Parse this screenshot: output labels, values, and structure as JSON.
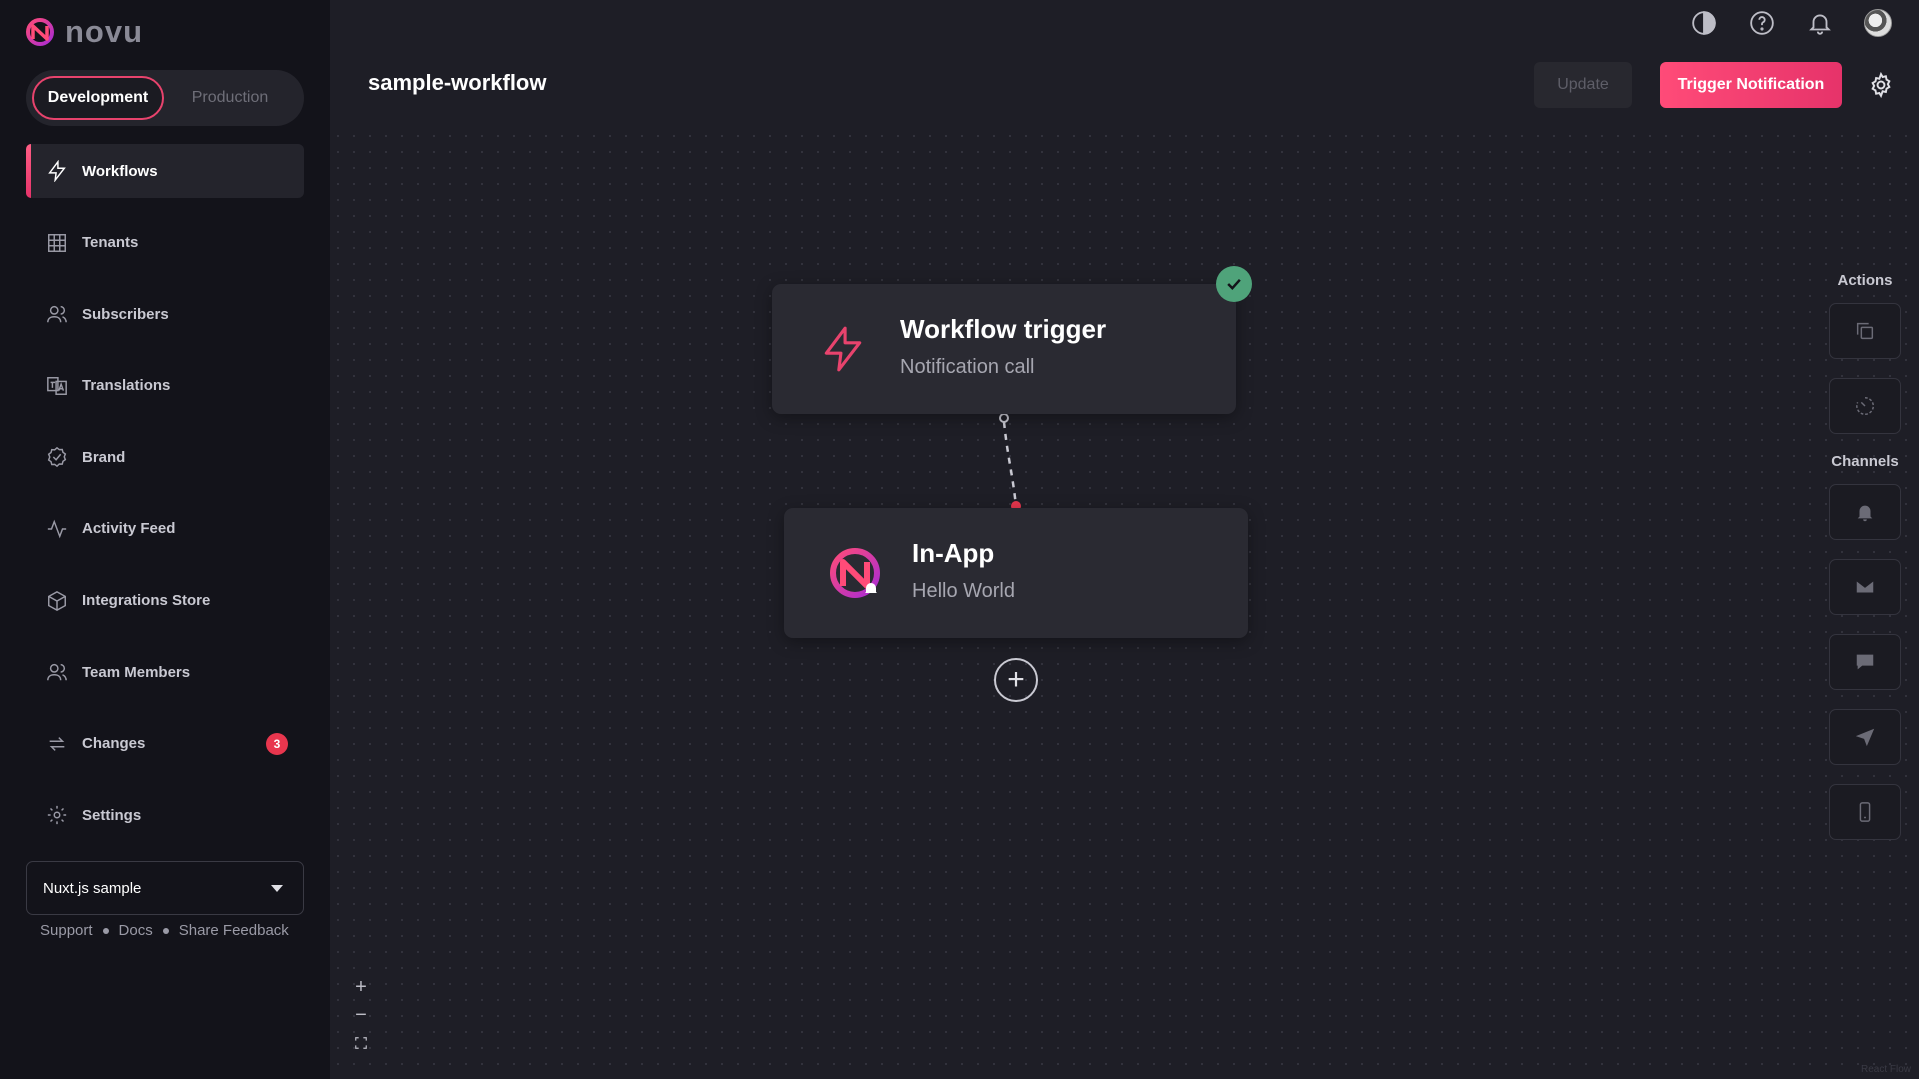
{
  "app": {
    "brand": "novu",
    "accent_color": "#e8436d"
  },
  "environment": {
    "options": [
      "Development",
      "Production"
    ],
    "selected": "Development"
  },
  "sidebar": {
    "items": [
      {
        "label": "Workflows",
        "icon": "bolt-icon",
        "active": true
      },
      {
        "label": "Tenants",
        "icon": "building-icon"
      },
      {
        "label": "Subscribers",
        "icon": "users-icon"
      },
      {
        "label": "Translations",
        "icon": "translate-icon"
      },
      {
        "label": "Brand",
        "icon": "badge-check-icon"
      },
      {
        "label": "Activity Feed",
        "icon": "activity-icon"
      },
      {
        "label": "Integrations Store",
        "icon": "box-icon"
      },
      {
        "label": "Team Members",
        "icon": "team-icon"
      },
      {
        "label": "Changes",
        "icon": "sync-icon",
        "badge": "3"
      },
      {
        "label": "Settings",
        "icon": "gear-icon"
      }
    ],
    "organization": "Nuxt.js sample",
    "footer_links": [
      "Support",
      "Docs",
      "Share Feedback"
    ]
  },
  "header": {
    "title": "sample-workflow",
    "update_label": "Update",
    "trigger_label": "Trigger Notification"
  },
  "canvas": {
    "trigger_node": {
      "title": "Workflow trigger",
      "subtitle": "Notification call"
    },
    "inapp_node": {
      "title": "In-App",
      "subtitle": "Hello World"
    }
  },
  "panel": {
    "actions_title": "Actions",
    "channels_title": "Channels"
  },
  "attribution": "React Flow"
}
